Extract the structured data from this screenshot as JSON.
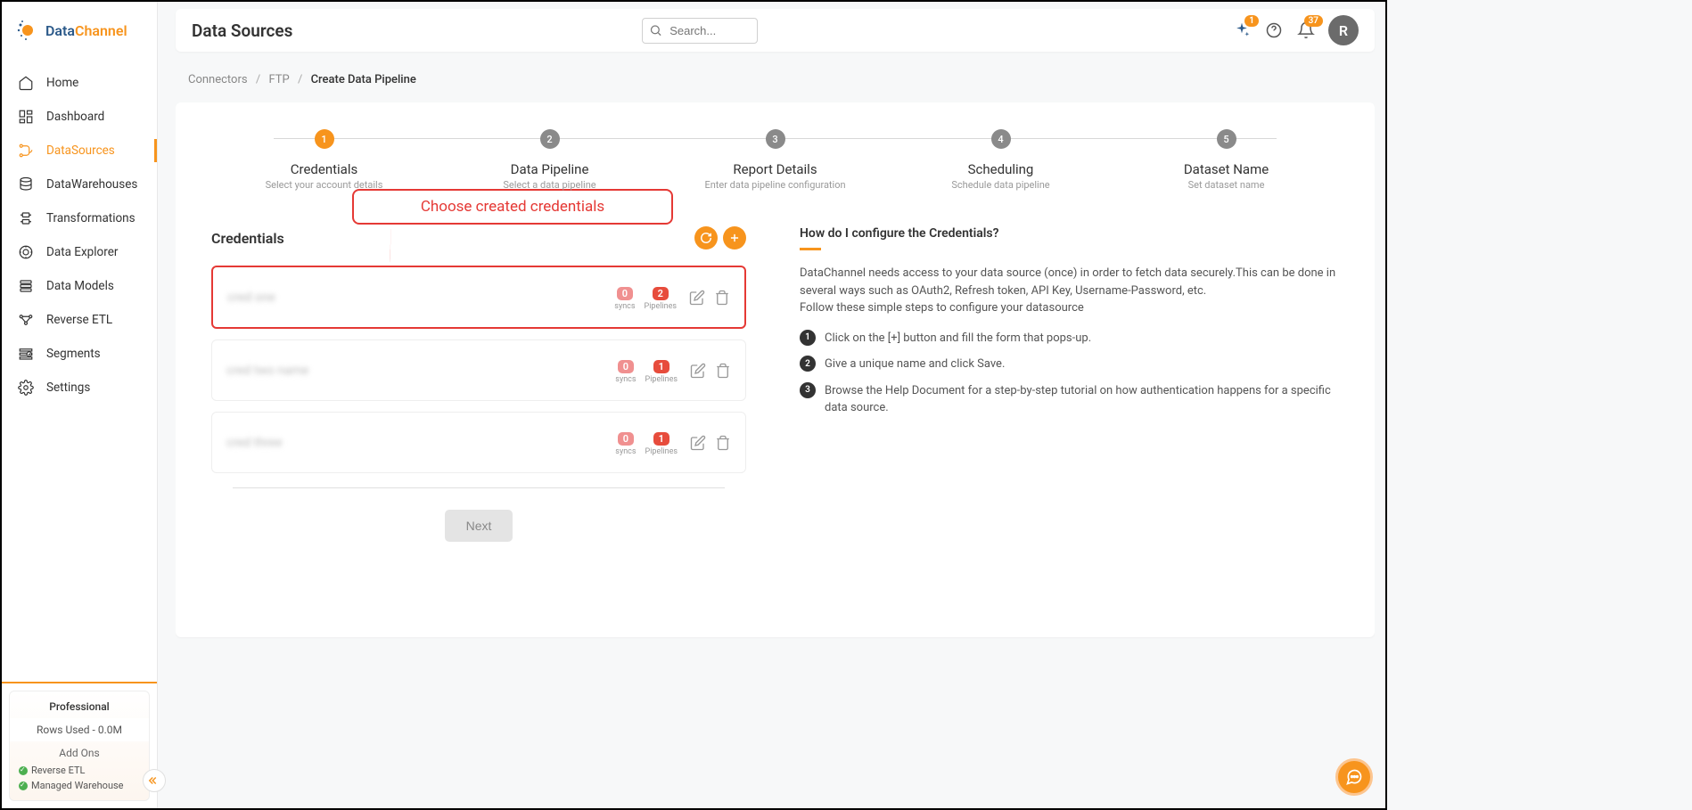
{
  "brand": {
    "name1": "Data",
    "name2": "Channel"
  },
  "nav": [
    {
      "label": "Home"
    },
    {
      "label": "Dashboard"
    },
    {
      "label": "DataSources"
    },
    {
      "label": "DataWarehouses"
    },
    {
      "label": "Transformations"
    },
    {
      "label": "Data Explorer"
    },
    {
      "label": "Data Models"
    },
    {
      "label": "Reverse ETL"
    },
    {
      "label": "Segments"
    },
    {
      "label": "Settings"
    }
  ],
  "plan": {
    "title": "Professional",
    "rows": "Rows Used - 0.0M",
    "addons_title": "Add Ons",
    "addons": [
      "Reverse ETL",
      "Managed Warehouse"
    ]
  },
  "header": {
    "title": "Data Sources",
    "search_placeholder": "Search...",
    "sparkle_badge": "1",
    "bell_badge": "37",
    "avatar": "R"
  },
  "breadcrumb": {
    "a": "Connectors",
    "b": "FTP",
    "c": "Create Data Pipeline"
  },
  "steps": [
    {
      "num": "1",
      "title": "Credentials",
      "sub": "Select your account details"
    },
    {
      "num": "2",
      "title": "Data Pipeline",
      "sub": "Select a data pipeline"
    },
    {
      "num": "3",
      "title": "Report Details",
      "sub": "Enter data pipeline configuration"
    },
    {
      "num": "4",
      "title": "Scheduling",
      "sub": "Schedule data pipeline"
    },
    {
      "num": "5",
      "title": "Dataset Name",
      "sub": "Set dataset name"
    }
  ],
  "callout": "Choose created credentials",
  "section": {
    "title": "Credentials"
  },
  "credentials": [
    {
      "name": "cred one",
      "syncs": "0",
      "pipelines": "2"
    },
    {
      "name": "cred two name",
      "syncs": "0",
      "pipelines": "1"
    },
    {
      "name": "cred three",
      "syncs": "0",
      "pipelines": "1"
    }
  ],
  "labels": {
    "syncs": "syncs",
    "pipelines": "Pipelines",
    "next": "Next"
  },
  "help": {
    "title": "How do I configure the Credentials?",
    "body": "DataChannel needs access to your data source (once) in order to fetch data securely.This can be done in several ways such as OAuth2, Refresh token, API Key, Username-Password, etc.\nFollow these simple steps to configure your datasource",
    "steps": [
      "Click on the [+] button and fill the form that pops-up.",
      "Give a unique name and click Save.",
      "Browse the Help Document for a step-by-step tutorial on how authentication happens for a specific data source."
    ]
  }
}
